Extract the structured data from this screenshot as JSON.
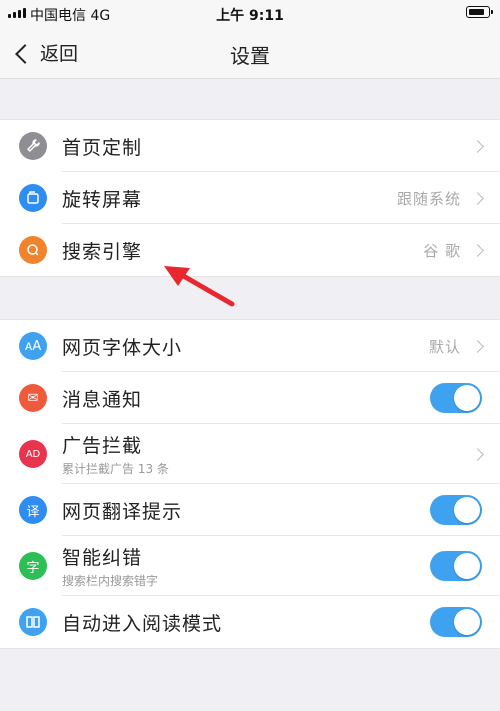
{
  "status_bar": {
    "carrier": "中国电信  4G",
    "time": "上午 9:11"
  },
  "nav": {
    "back_label": "返回",
    "title": "设置"
  },
  "section1": [
    {
      "label": "首页定制",
      "value": "",
      "icon": "wrench-icon",
      "color": "#8e8e93"
    },
    {
      "label": "旋转屏幕",
      "value": "跟随系统",
      "icon": "rotate-icon",
      "color": "#2f8cf0"
    },
    {
      "label": "搜索引擎",
      "value": "谷 歌",
      "icon": "search-icon",
      "color": "#f0832b"
    }
  ],
  "section2": [
    {
      "label": "网页字体大小",
      "value": "默认",
      "icon": "font-size-icon",
      "color": "#3ea2f1",
      "glyph": "ᴀA"
    },
    {
      "label": "消息通知",
      "toggle": true,
      "icon": "message-icon",
      "color": "#f05a3c",
      "glyph": "✉"
    },
    {
      "label": "广告拦截",
      "sub": "累计拦截广告 13 条",
      "icon": "ad-block-icon",
      "color": "#e8344c",
      "glyph": "AD"
    },
    {
      "label": "网页翻译提示",
      "toggle": true,
      "icon": "translate-icon",
      "color": "#2f8cf0",
      "glyph": "译"
    },
    {
      "label": "智能纠错",
      "sub": "搜索栏内搜索错字",
      "toggle": true,
      "icon": "correction-icon",
      "color": "#2dbf56",
      "glyph": "字"
    },
    {
      "label": "自动进入阅读模式",
      "toggle": true,
      "icon": "book-icon",
      "color": "#3ea2f1",
      "glyph": "▯▯"
    }
  ],
  "colors": {
    "accent": "#3ea2f1",
    "annotation_arrow": "#e8282e"
  }
}
